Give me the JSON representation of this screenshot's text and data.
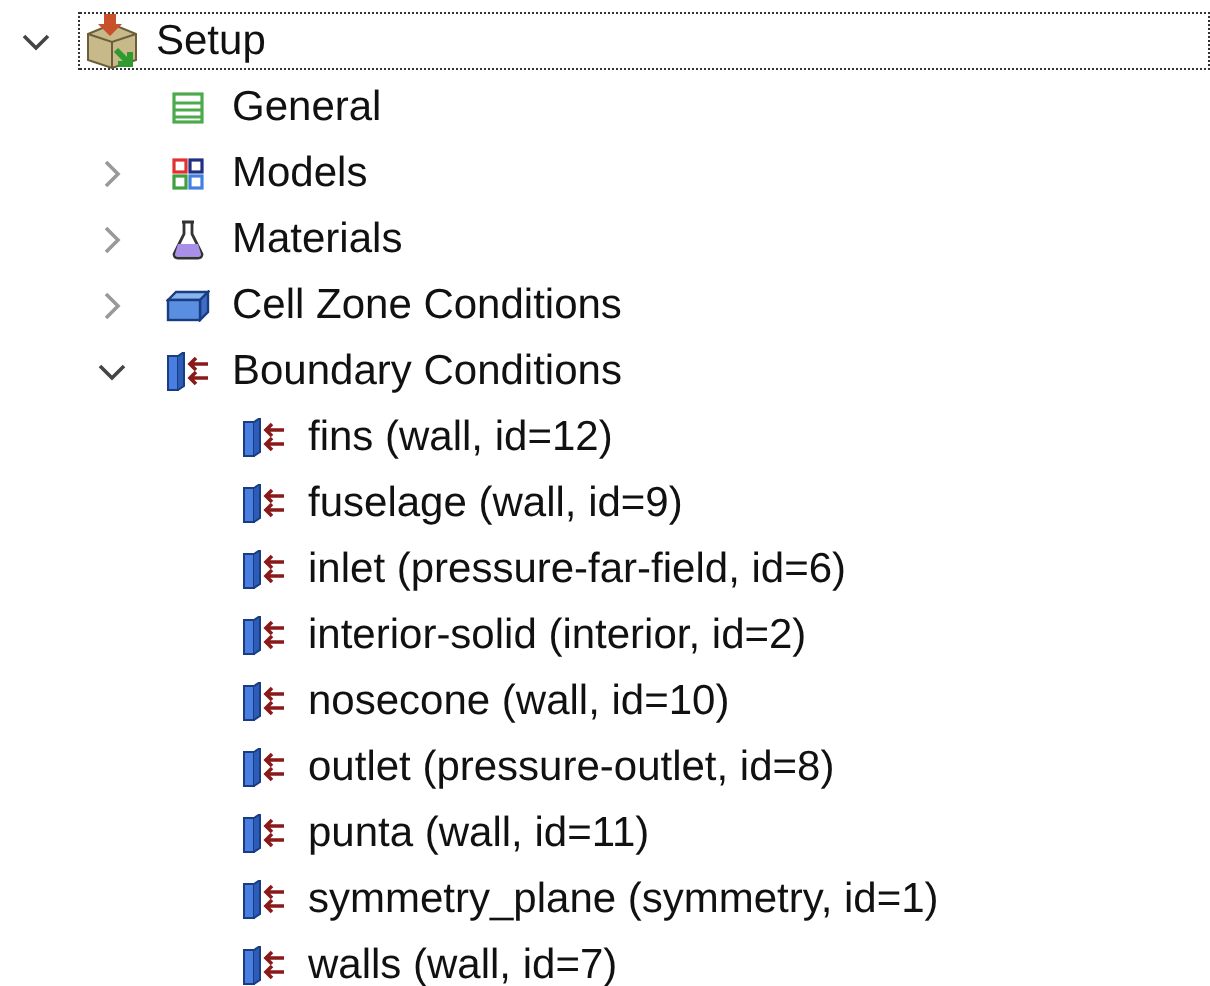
{
  "tree": [
    {
      "label": "Setup",
      "kind": "setup",
      "expanded": true,
      "focused": true,
      "children": [
        {
          "label": "General",
          "kind": "general",
          "focused": false
        },
        {
          "label": "Models",
          "kind": "models",
          "expanded": false,
          "focused": false
        },
        {
          "label": "Materials",
          "kind": "materials",
          "expanded": false,
          "focused": false
        },
        {
          "label": "Cell Zone Conditions",
          "kind": "zone",
          "expanded": false,
          "focused": false
        },
        {
          "label": "Boundary Conditions",
          "kind": "boundary",
          "expanded": true,
          "focused": false,
          "children": [
            {
              "label": "fins (wall, id=12)",
              "kind": "boundary",
              "focused": false
            },
            {
              "label": "fuselage (wall, id=9)",
              "kind": "boundary",
              "focused": false
            },
            {
              "label": "inlet (pressure-far-field, id=6)",
              "kind": "boundary",
              "focused": false
            },
            {
              "label": "interior-solid (interior, id=2)",
              "kind": "boundary",
              "focused": false
            },
            {
              "label": "nosecone (wall, id=10)",
              "kind": "boundary",
              "focused": false
            },
            {
              "label": "outlet (pressure-outlet, id=8)",
              "kind": "boundary",
              "focused": false
            },
            {
              "label": "punta (wall, id=11)",
              "kind": "boundary",
              "focused": false
            },
            {
              "label": "symmetry_plane (symmetry, id=1)",
              "kind": "boundary",
              "focused": false
            },
            {
              "label": "walls (wall, id=7)",
              "kind": "boundary",
              "focused": false
            }
          ]
        }
      ]
    }
  ]
}
